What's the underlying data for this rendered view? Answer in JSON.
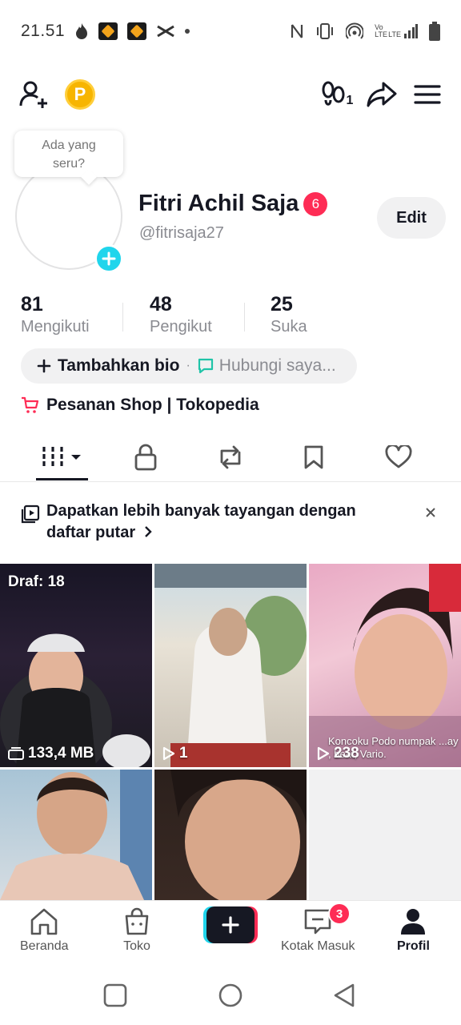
{
  "status_bar": {
    "time": "21.51",
    "left_icons": [
      "flame-icon",
      "app-icon",
      "app-icon",
      "capcut-icon",
      "dot"
    ],
    "right_icons": [
      "nfc-icon",
      "vibrate-icon",
      "hotspot-icon",
      "volte-icon",
      "lte-icon",
      "signal-icon",
      "battery-icon"
    ],
    "volte_label": "Vo LTE",
    "lte_label": "LTE"
  },
  "top_bar": {
    "add_friend_icon": "add-user-icon",
    "coin_letter": "P",
    "footprint_count": "1",
    "share_icon": "share-icon",
    "menu_icon": "menu-icon"
  },
  "profile": {
    "bubble_text_line1": "Ada yang",
    "bubble_text_line2": "seru?",
    "name": "Fitri Achil Saja",
    "badge_count": "6",
    "handle": "@fitrisaja27",
    "edit_label": "Edit"
  },
  "stats": [
    {
      "value": "81",
      "label": "Mengikuti"
    },
    {
      "value": "48",
      "label": "Pengikut"
    },
    {
      "value": "25",
      "label": "Suka"
    }
  ],
  "bio": {
    "add_bio_label": "Tambahkan bio",
    "separator": "·",
    "contact_label": "Hubungi saya..."
  },
  "shop": {
    "label": "Pesanan Shop | Tokopedia"
  },
  "tabs": [
    {
      "icon": "grid-icon",
      "active": true
    },
    {
      "icon": "lock-icon",
      "active": false
    },
    {
      "icon": "repost-icon",
      "active": false
    },
    {
      "icon": "bookmark-icon",
      "active": false
    },
    {
      "icon": "heart-icon",
      "active": false
    }
  ],
  "playlist_banner": {
    "text": "Dapatkan lebih banyak tayangan dengan daftar putar"
  },
  "videos": [
    {
      "label": "Draf: 18",
      "stat": "133,4 MB",
      "stat_icon": "drafts-icon"
    },
    {
      "stat": "1",
      "stat_icon": "play-icon"
    },
    {
      "stat": "238",
      "stat_icon": "play-icon",
      "caption": "Koncoku Podo numpak ...ay , beat, Vario."
    },
    {},
    {}
  ],
  "bottom_nav": {
    "home": "Beranda",
    "shop": "Toko",
    "inbox": "Kotak Masuk",
    "inbox_badge": "3",
    "profile": "Profil"
  },
  "colors": {
    "accent_red": "#fe2c55",
    "accent_cyan": "#20d5ec",
    "text_primary": "#161823",
    "text_secondary": "#8a8b91",
    "coin_gold": "#f7b500"
  }
}
